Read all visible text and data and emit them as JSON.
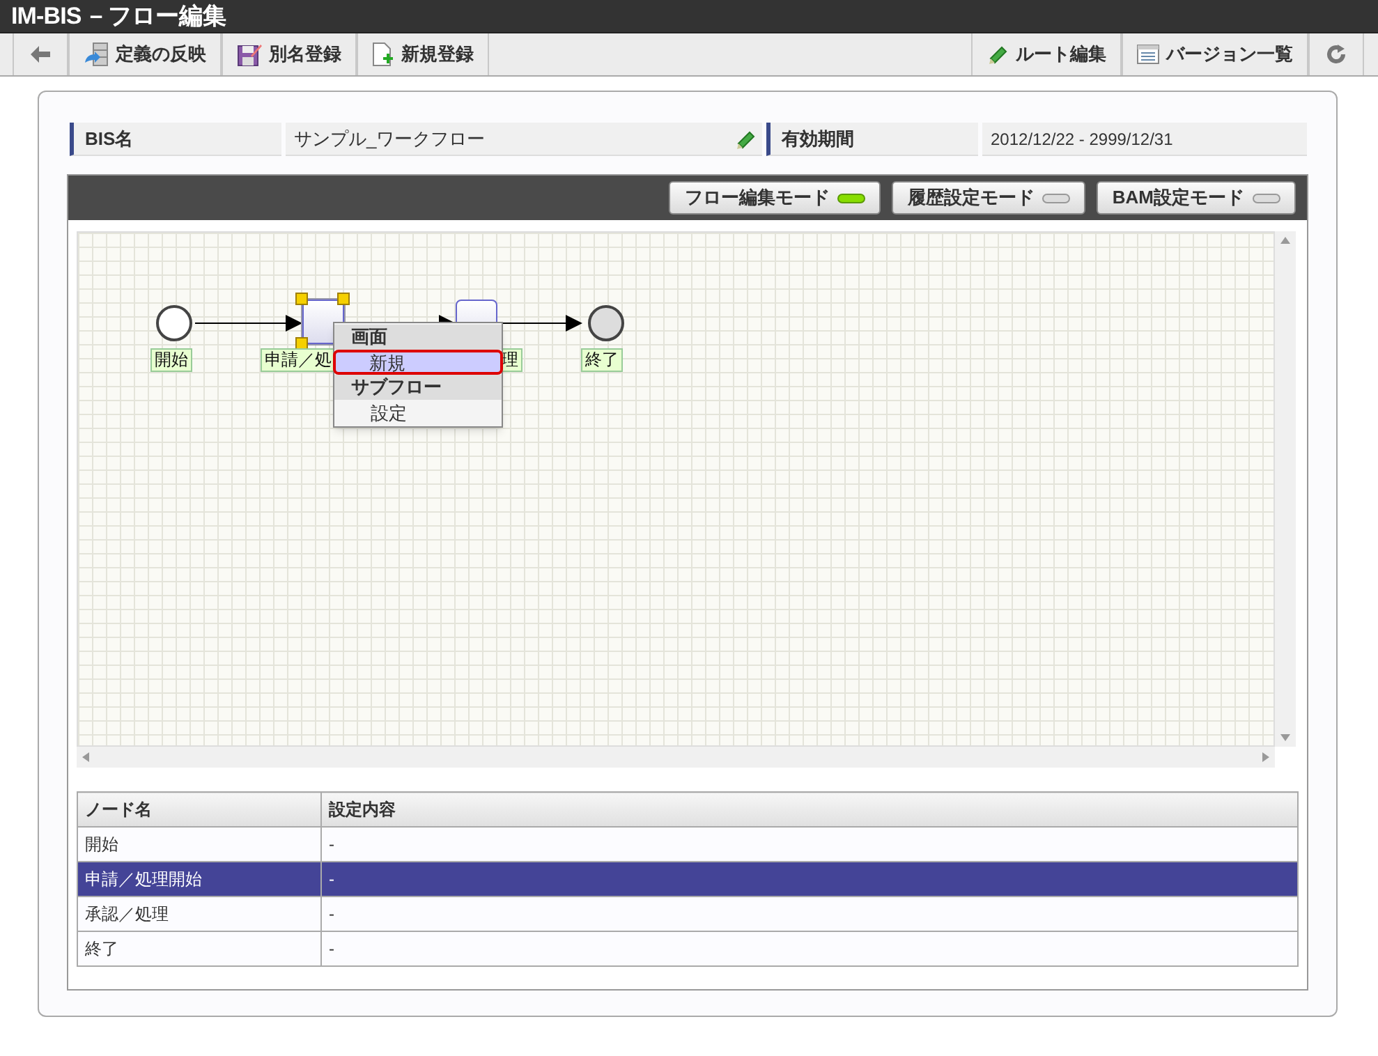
{
  "window": {
    "brand": "IM-BIS",
    "title": "－フロー編集"
  },
  "toolbar": {
    "left": [
      {
        "kind": "back"
      },
      {
        "kind": "reflect",
        "label": "定義の反映"
      },
      {
        "kind": "alias",
        "label": "別名登録"
      },
      {
        "kind": "new",
        "label": "新規登録"
      }
    ],
    "right": [
      {
        "kind": "route",
        "label": "ルート編集"
      },
      {
        "kind": "versions",
        "label": "バージョン一覧"
      },
      {
        "kind": "refresh"
      }
    ]
  },
  "info": {
    "bis_name_label": "BIS名",
    "bis_name": "サンプル_ワークフロー",
    "period_label": "有効期間",
    "period": "2012/12/22 - 2999/12/31"
  },
  "modes": [
    {
      "label": "フロー編集モード",
      "on": true
    },
    {
      "label": "履歴設定モード",
      "on": false
    },
    {
      "label": "BAM設定モード",
      "on": false
    }
  ],
  "diagram": {
    "nodes": [
      {
        "kind": "start",
        "label": "開始",
        "selected": false
      },
      {
        "kind": "task",
        "label": "申請／処",
        "selected": true
      },
      {
        "kind": "task",
        "label": "理",
        "selected": false
      },
      {
        "kind": "end",
        "label": "終了",
        "selected": false
      }
    ],
    "context_menu": [
      {
        "kind": "heading",
        "label": "画面"
      },
      {
        "kind": "item",
        "label": "新規",
        "selected": true
      },
      {
        "kind": "heading",
        "label": "サブフロー"
      },
      {
        "kind": "item",
        "label": "設定",
        "selected": false
      }
    ]
  },
  "table": {
    "columns": [
      "ノード名",
      "設定内容"
    ],
    "rows": [
      {
        "cells": [
          "開始",
          "-"
        ],
        "selected": false
      },
      {
        "cells": [
          "申請／処理開始",
          "-"
        ],
        "selected": true
      },
      {
        "cells": [
          "承認／処理",
          "-"
        ],
        "selected": false
      },
      {
        "cells": [
          "終了",
          "-"
        ],
        "selected": false
      }
    ]
  }
}
